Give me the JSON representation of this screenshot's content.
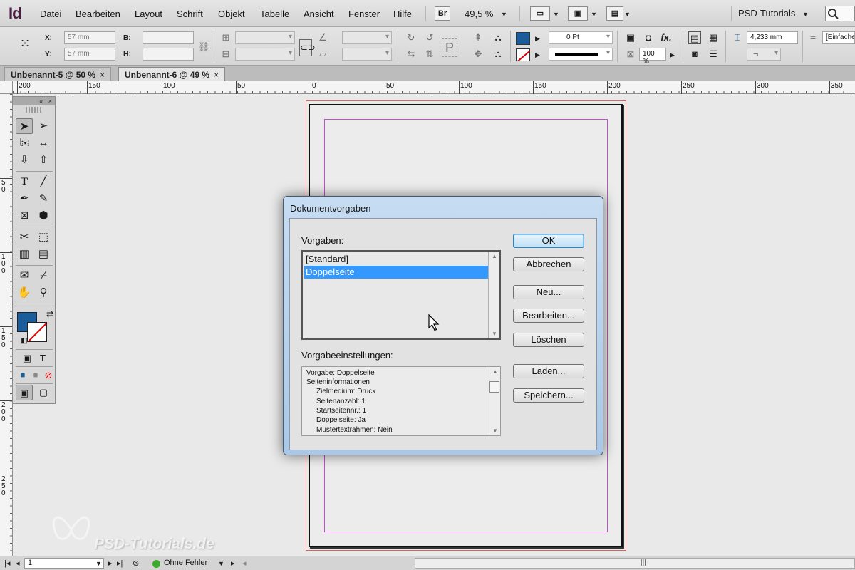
{
  "app": {
    "logo": "Id"
  },
  "menu": [
    "Datei",
    "Bearbeiten",
    "Layout",
    "Schrift",
    "Objekt",
    "Tabelle",
    "Ansicht",
    "Fenster",
    "Hilfe"
  ],
  "menubar": {
    "bridge_label": "Br",
    "zoom": "49,5 %",
    "workspace": "PSD-Tutorials",
    "search_icon": "search-icon"
  },
  "control": {
    "x_label": "X:",
    "y_label": "Y:",
    "w_label": "B:",
    "h_label": "H:",
    "x_value": "57 mm",
    "y_value": "57 mm",
    "stroke_weight": "0 Pt",
    "opacity": "100 %",
    "offset": "4,233 mm",
    "style": "[Einfache"
  },
  "tabs": [
    {
      "label": "Unbenannt-5 @ 50 %",
      "close": "×"
    },
    {
      "label": "Unbenannt-6 @ 49 %",
      "close": "×"
    }
  ],
  "ruler_h": [
    "200",
    "150",
    "100",
    "50",
    "0",
    "50",
    "100",
    "150",
    "200",
    "250",
    "300",
    "350"
  ],
  "ruler_v": [
    "5",
    "0",
    "1",
    "0",
    "0",
    "1",
    "5",
    "0",
    "2",
    "0",
    "0",
    "2",
    "5",
    "0"
  ],
  "tools": {
    "collapse": "«",
    "close": "×"
  },
  "dialog": {
    "title": "Dokumentvorgaben",
    "presets_label": "Vorgaben:",
    "presets": [
      "[Standard]",
      "Doppelseite"
    ],
    "selected_preset": "Doppelseite",
    "settings_label": "Vorgabeeinstellungen:",
    "settings_lines": [
      "Vorgabe: Doppelseite",
      "Seiteninformationen",
      "Zielmedium: Druck",
      "Seitenanzahl: 1",
      "Startseitennr.: 1",
      "Doppelseite: Ja",
      "Mustertextrahmen: Nein"
    ],
    "buttons": {
      "ok": "OK",
      "cancel": "Abbrechen",
      "new": "Neu...",
      "edit": "Bearbeiten...",
      "delete": "Löschen",
      "load": "Laden...",
      "save": "Speichern..."
    }
  },
  "statusbar": {
    "page": "1",
    "preflight": "Ohne Fehler"
  },
  "watermark": "PSD-Tutorials.de",
  "colors": {
    "fill": "#1a5d9a",
    "selection": "#3399ff",
    "margin_guide": "#c050c8",
    "bleed_guide": "#e06060"
  }
}
